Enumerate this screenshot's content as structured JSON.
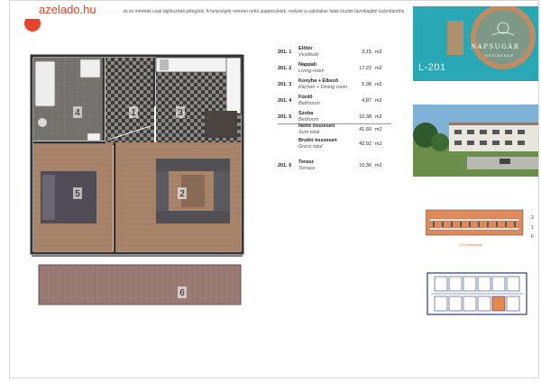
{
  "watermark": {
    "text": "azelado.hu"
  },
  "disclaimer": {
    "text": "...k illusztráció. A megadott alapterületek és méretek csak tájékoztató jellegűek. A helyiségek méretei nettó alapterületek, melyek a vakolatlan falak közötti távolságból számítandók."
  },
  "plan": {
    "room_labels": [
      "4",
      "3",
      "1",
      "5",
      "2",
      "6"
    ]
  },
  "rooms": [
    {
      "num": "201. 1",
      "hu": "Előtér",
      "en": "Vestibule",
      "area": "3,15",
      "unit": "m2"
    },
    {
      "num": "201. 2",
      "hu": "Nappali",
      "en": "Living-room",
      "area": "17,22",
      "unit": "m2"
    },
    {
      "num": "201. 3",
      "hu": "Konyha + Étkező",
      "en": "Kitchen + Dining room",
      "area": "5,98",
      "unit": "m2"
    },
    {
      "num": "201. 4",
      "hu": "Fürdő",
      "en": "Bathroom",
      "area": "4,87",
      "unit": "m2"
    },
    {
      "num": "201. 5",
      "hu": "Szoba",
      "en": "Bedroom",
      "area": "10,38",
      "unit": "m2"
    }
  ],
  "totals": [
    {
      "hu": "Nettó összesen",
      "en": "Sum total",
      "area": "41,60",
      "unit": "m2"
    },
    {
      "hu": "Bruttó összesen",
      "en": "Gross total",
      "area": "42,92",
      "unit": "m2"
    }
  ],
  "terrace": {
    "num": "201. 6",
    "hu": "Terasz",
    "en": "Terrace",
    "area": "10,36",
    "unit": "m2"
  },
  "panel": {
    "unit_code": "L-201",
    "brand": "NAPSUGÁR",
    "brand_sub": "RESIDENCE",
    "colors": {
      "teal": "#2aa7b4",
      "orange": "#e8864e"
    },
    "floor_labels": [
      "2",
      "1",
      "F"
    ],
    "facade_caption": "K-I homlokzat"
  }
}
